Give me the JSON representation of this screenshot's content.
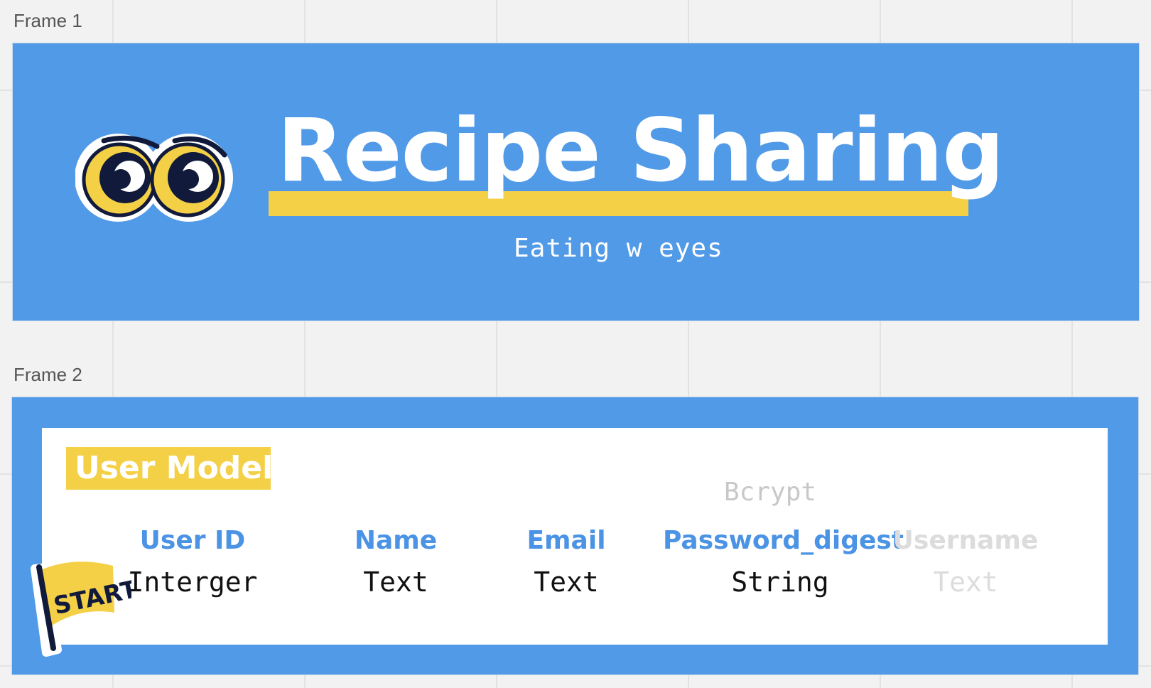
{
  "canvas": {
    "frames": [
      {
        "label": "Frame 1",
        "title": "Recipe Sharing",
        "subtitle": "Eating w eyes",
        "sticker": "googly-eyes-icon"
      },
      {
        "label": "Frame 2",
        "model_title": "User Model",
        "note": "Bcrypt",
        "columns": [
          {
            "name": "User ID",
            "type": "Interger",
            "muted": false
          },
          {
            "name": "Name",
            "type": "Text",
            "muted": false
          },
          {
            "name": "Email",
            "type": "Text",
            "muted": false
          },
          {
            "name": "Password_digest",
            "type": "String",
            "muted": false
          },
          {
            "name": "Username",
            "type": "Text",
            "muted": true
          }
        ],
        "sticker_text": "START"
      }
    ]
  },
  "colors": {
    "background": "#f2f2f2",
    "frame_blue": "#519ae7",
    "accent_yellow": "#f4d047",
    "header_blue": "#4b93e4",
    "muted_gray": "#dcdcdc",
    "navy": "#111a3a"
  }
}
